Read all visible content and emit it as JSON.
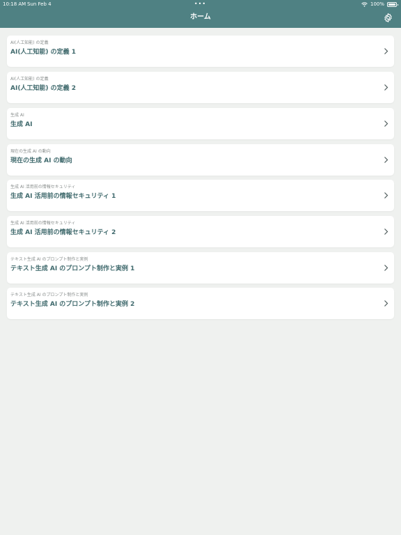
{
  "status_bar": {
    "time": "10:18 AM",
    "date": "Sun Feb 4",
    "dots": "•••",
    "battery": "100%"
  },
  "nav": {
    "title": "ホーム",
    "settings_icon": "gear-icon"
  },
  "items": [
    {
      "subtitle": "AI(人工知能) の定義",
      "title": "AI(人工知能) の定義 1"
    },
    {
      "subtitle": "AI(人工知能) の定義",
      "title": "AI(人工知能) の定義 2"
    },
    {
      "subtitle": "生成 AI",
      "title": "生成 AI"
    },
    {
      "subtitle": "現在の生成 AI の動向",
      "title": "現在の生成 AI の動向"
    },
    {
      "subtitle": "生成 AI 活用前の情報セキュリティ",
      "title": "生成 AI 活用前の情報セキュリティ 1"
    },
    {
      "subtitle": "生成 AI 活用前の情報セキュリティ",
      "title": "生成 AI 活用前の情報セキュリティ 2"
    },
    {
      "subtitle": "テキスト生成 AI のプロンプト制作と実例",
      "title": "テキスト生成 AI のプロンプト制作と実例 1"
    },
    {
      "subtitle": "テキスト生成 AI のプロンプト制作と実例",
      "title": "テキスト生成 AI のプロンプト制作と実例 2"
    }
  ],
  "colors": {
    "header": "#4f8183",
    "background": "#eff1ef",
    "card": "#ffffff",
    "title_text": "#406a6d"
  }
}
